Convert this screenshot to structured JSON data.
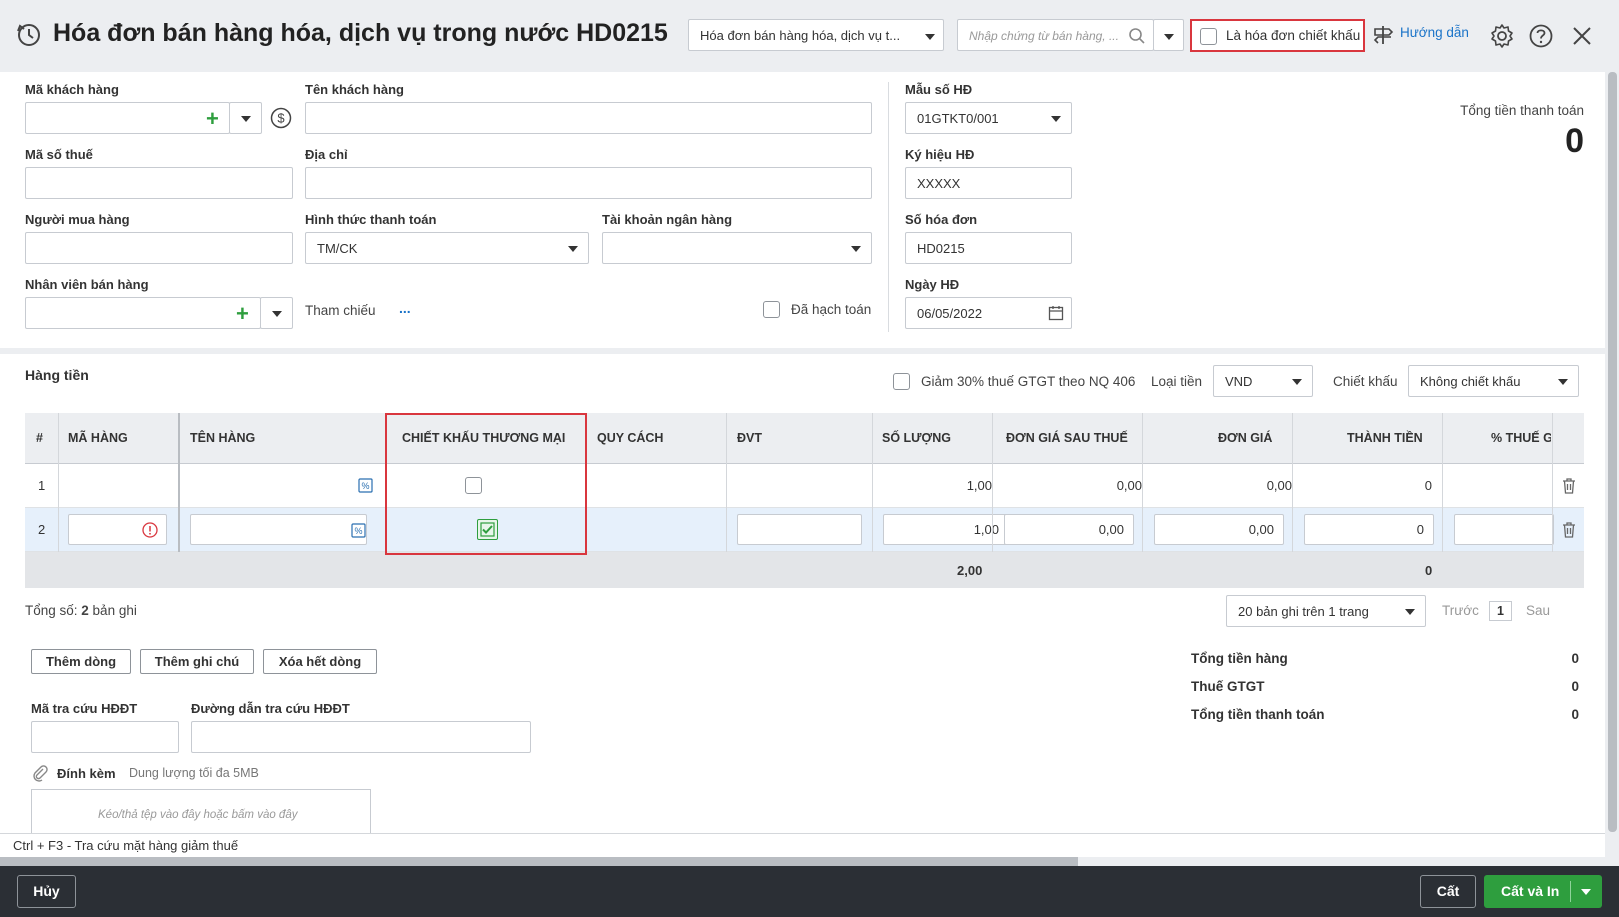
{
  "header": {
    "title": "Hóa đơn bán hàng hóa, dịch vụ trong nước HD0215",
    "invoice_type_select": "Hóa đơn bán hàng hóa, dịch vụ t...",
    "search_placeholder": "Nhập chứng từ bán hàng, ...",
    "discount_invoice_label": "Là hóa đơn chiết khấu",
    "guide_label": "Hướng dẫn"
  },
  "form": {
    "customer_code_label": "Mã khách hàng",
    "customer_name_label": "Tên khách hàng",
    "tax_code_label": "Mã số thuế",
    "address_label": "Địa chỉ",
    "buyer_label": "Người mua hàng",
    "payment_method_label": "Hình thức thanh toán",
    "payment_method_value": "TM/CK",
    "bank_account_label": "Tài khoản ngân hàng",
    "salesperson_label": "Nhân viên bán hàng",
    "reference_label": "Tham chiếu",
    "reference_link": "...",
    "posted_label": "Đã hạch toán",
    "template_label": "Mẫu số HĐ",
    "template_value": "01GTKT0/001",
    "symbol_label": "Ký hiệu HĐ",
    "symbol_value": "XXXXX",
    "invoice_no_label": "Số hóa đơn",
    "invoice_no_value": "HD0215",
    "date_label": "Ngày HĐ",
    "date_value": "06/05/2022",
    "total_label": "Tổng tiền thanh toán",
    "total_value": "0"
  },
  "goods": {
    "section_title": "Hàng tiền",
    "vat_reduction_label": "Giảm 30% thuế GTGT theo NQ 406",
    "currency_label": "Loại tiền",
    "currency_value": "VND",
    "discount_label": "Chiết khấu",
    "discount_value": "Không chiết khấu"
  },
  "table": {
    "headers": [
      "#",
      "MÃ HÀNG",
      "TÊN HÀNG",
      "CHIẾT KHẤU THƯƠNG MẠI",
      "QUY CÁCH",
      "ĐVT",
      "SỐ LƯỢNG",
      "ĐƠN GIÁ SAU THUẾ",
      "ĐƠN GIÁ",
      "THÀNH TIỀN",
      "% THUẾ GT"
    ],
    "rows": [
      {
        "no": "1",
        "qty": "1,00",
        "price_after_tax": "0,00",
        "price": "0,00",
        "amount": "0",
        "discount_checked": false
      },
      {
        "no": "2",
        "qty": "1,00",
        "price_after_tax": "0,00",
        "price": "0,00",
        "amount": "0",
        "discount_checked": true
      }
    ],
    "footer_qty_total": "2,00",
    "footer_amount_total": "0"
  },
  "pagination": {
    "total_prefix": "Tổng số: ",
    "total_count": "2",
    "total_suffix": " bản ghi",
    "page_size": "20 bản ghi trên 1 trang",
    "prev": "Trước",
    "page": "1",
    "next": "Sau"
  },
  "actions": {
    "add_row": "Thêm dòng",
    "add_note": "Thêm ghi chú",
    "delete_all": "Xóa hết dòng"
  },
  "summary": {
    "goods_total_label": "Tổng tiền hàng",
    "goods_total_value": "0",
    "vat_label": "Thuế GTGT",
    "vat_value": "0",
    "payment_total_label": "Tổng tiền thanh toán",
    "payment_total_value": "0"
  },
  "einvoice": {
    "lookup_code_label": "Mã tra cứu HĐĐT",
    "lookup_url_label": "Đường dẫn tra cứu HĐĐT",
    "attach_label": "Đính kèm",
    "attach_limit": "Dung lượng tối đa 5MB",
    "drop_hint": "Kéo/thả tệp vào đây hoặc bấm vào đây"
  },
  "status_bar": {
    "hint": "Ctrl + F3 - Tra cứu mặt hàng giảm thuế"
  },
  "footer": {
    "cancel": "Hủy",
    "save": "Cất",
    "save_print": "Cất và In"
  },
  "colors": {
    "accent_red": "#d9363e",
    "green": "#2e9e3e",
    "dark_footer": "#2b2f35",
    "link_blue": "#1a73c8"
  }
}
